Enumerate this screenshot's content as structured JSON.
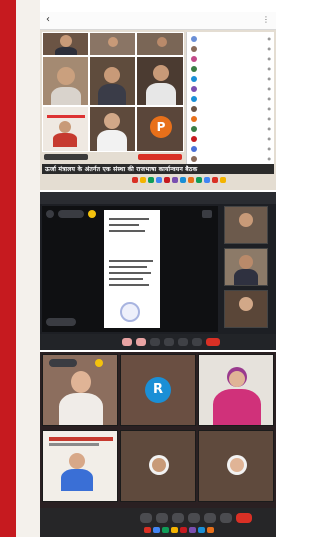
{
  "shot1": {
    "toolbar": {
      "back": "‹",
      "menu": "⋮"
    },
    "tiles": [
      {
        "label": ""
      },
      {
        "label": ""
      },
      {
        "label": ""
      },
      {
        "label": ""
      },
      {
        "label": ""
      },
      {
        "label": ""
      }
    ],
    "avatar_letter": "P",
    "participants": [
      "",
      "",
      "",
      "",
      "",
      "",
      "",
      "",
      "",
      "",
      "",
      "",
      ""
    ],
    "headline": "ऊर्जा मंत्रालय के अंतर्गत एक संस्था की राजभाषा कार्यान्वयन बैठक"
  },
  "shot2": {
    "title": "",
    "doc_lines": [
      "",
      "",
      "",
      "",
      ""
    ],
    "side_labels": [
      "",
      "",
      ""
    ]
  },
  "shot3": {
    "tiles": [
      {
        "label": ""
      },
      {
        "label": ""
      },
      {
        "label": ""
      },
      {
        "label": ""
      },
      {
        "label": ""
      },
      {
        "label": ""
      }
    ],
    "avatar_letter": "R"
  },
  "colors": {
    "accent_red": "#c61a1f",
    "avatar_orange": "#e8701a",
    "avatar_blue": "#1a8fd6",
    "end_call": "#d93025"
  }
}
